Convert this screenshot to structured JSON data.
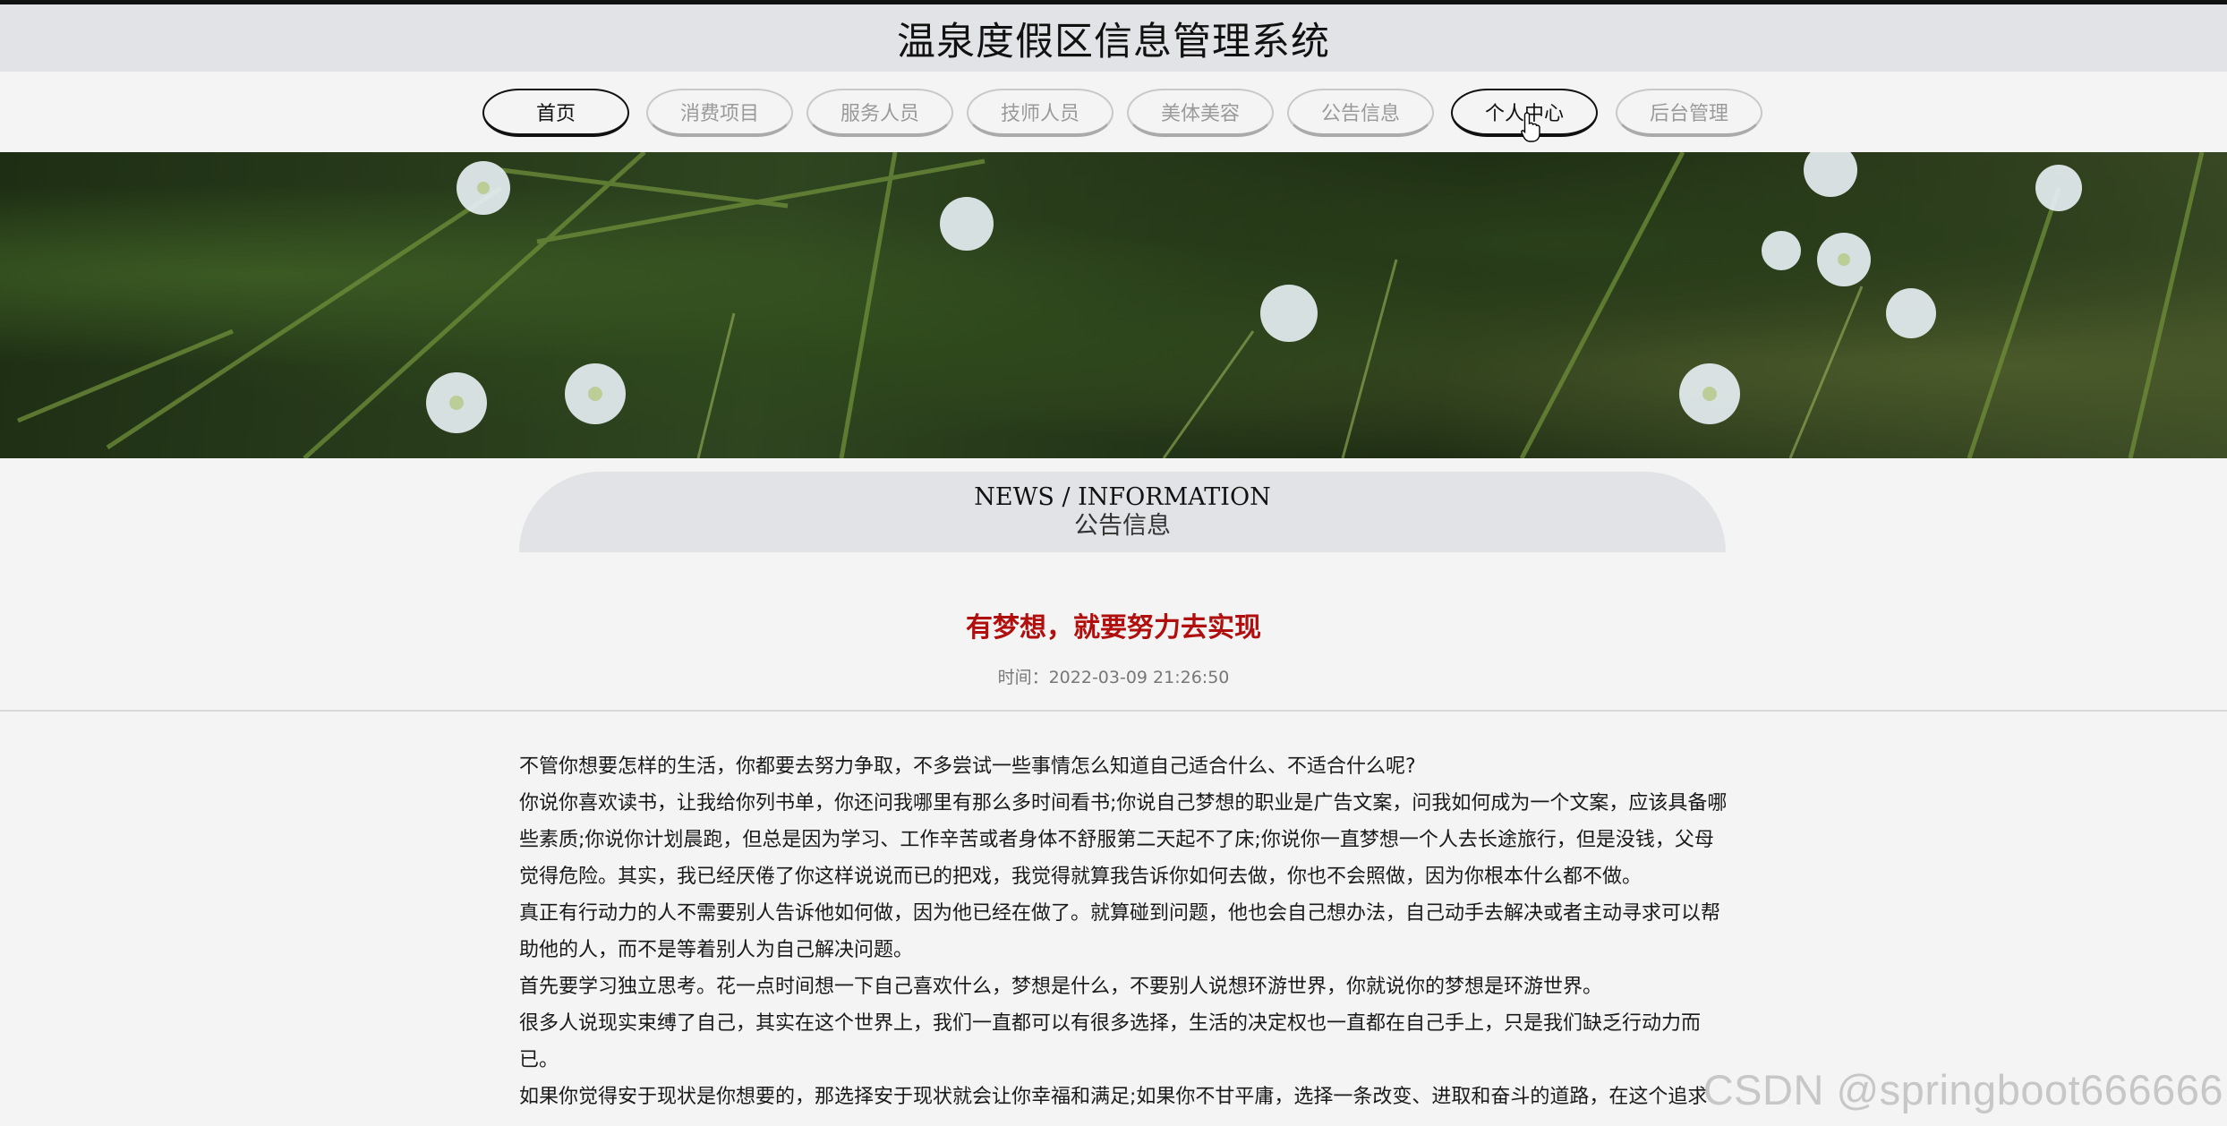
{
  "header": {
    "site_title": "温泉度假区信息管理系统"
  },
  "nav": {
    "items": [
      {
        "label": "首页"
      },
      {
        "label": "消费项目"
      },
      {
        "label": "服务人员"
      },
      {
        "label": "技师人员"
      },
      {
        "label": "美体美容"
      },
      {
        "label": "公告信息"
      },
      {
        "label": "个人中心"
      },
      {
        "label": "后台管理"
      }
    ]
  },
  "section": {
    "title_en": "NEWS / INFORMATION",
    "title_cn": "公告信息"
  },
  "article": {
    "title": "有梦想，就要努力去实现",
    "time_label": "时间：2022-03-09 21:26:50",
    "paragraphs": [
      "不管你想要怎样的生活，你都要去努力争取，不多尝试一些事情怎么知道自己适合什么、不适合什么呢?",
      "你说你喜欢读书，让我给你列书单，你还问我哪里有那么多时间看书;你说自己梦想的职业是广告文案，问我如何成为一个文案，应该具备哪些素质;你说你计划晨跑，但总是因为学习、工作辛苦或者身体不舒服第二天起不了床;你说你一直梦想一个人去长途旅行，但是没钱，父母觉得危险。其实，我已经厌倦了你这样说说而已的把戏，我觉得就算我告诉你如何去做，你也不会照做，因为你根本什么都不做。",
      "真正有行动力的人不需要别人告诉他如何做，因为他已经在做了。就算碰到问题，他也会自己想办法，自己动手去解决或者主动寻求可以帮助他的人，而不是等着别人为自己解决问题。",
      "首先要学习独立思考。花一点时间想一下自己喜欢什么，梦想是什么，不要别人说想环游世界，你就说你的梦想是环游世界。",
      "很多人说现实束缚了自己，其实在这个世界上，我们一直都可以有很多选择，生活的决定权也一直都在自己手上，只是我们缺乏行动力而已。",
      "如果你觉得安于现状是你想要的，那选择安于现状就会让你幸福和满足;如果你不甘平庸，选择一条改变、进取和奋斗的道路，在这个追求"
    ]
  },
  "watermark": "CSDN @springboot666666"
}
